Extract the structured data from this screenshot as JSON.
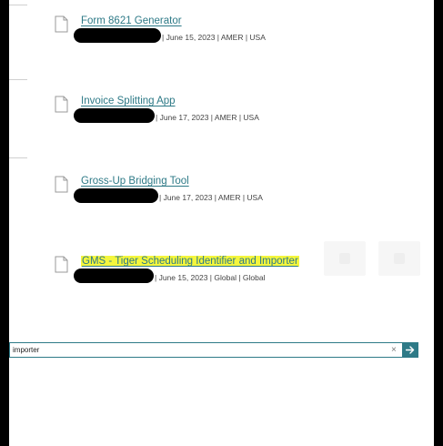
{
  "results": [
    {
      "title": "Form 8621 Generator",
      "meta": "| June 15, 2023 | AMER | USA"
    },
    {
      "title": "Invoice Splitting App",
      "meta": "| June 17, 2023 | AMER | USA"
    },
    {
      "title": "Gross-Up Bridging Tool",
      "meta": "| June 17, 2023 | AMER | USA"
    },
    {
      "title": "GMS - Tiger Scheduling Identifier and Importer",
      "meta": "| June 15, 2023 | Global | Global"
    }
  ],
  "search": {
    "value": "importer",
    "clear_glyph": "×"
  },
  "icons": {
    "result": "document-icon",
    "clear": "close-icon",
    "submit": "arrow-right-icon"
  },
  "colors": {
    "link": "#2e7a87",
    "highlight": "#f4f63d",
    "accent": "#2e7a87"
  }
}
